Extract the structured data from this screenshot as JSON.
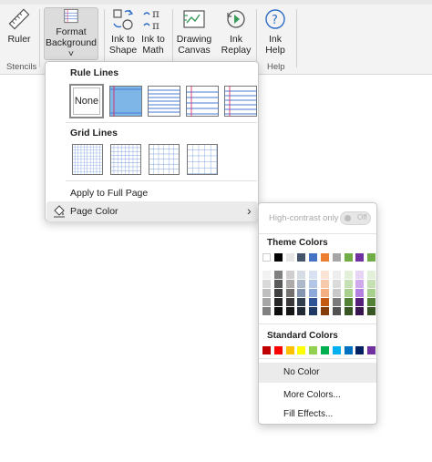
{
  "ribbon": {
    "ruler_label": "Ruler",
    "format_bg_line1": "Format",
    "format_bg_line2": "Background ˅",
    "ink_shape_line1": "Ink to",
    "ink_shape_line2": "Shape",
    "ink_math_line1": "Ink to",
    "ink_math_line2": "Math",
    "drawing_line1": "Drawing",
    "drawing_line2": "Canvas",
    "replay_line1": "Ink",
    "replay_line2": "Replay",
    "help_line1": "Ink",
    "help_line2": "Help",
    "group_stencils": "Stencils",
    "group_help": "Help"
  },
  "format_menu": {
    "rule_lines_heading": "Rule Lines",
    "none_label": "None",
    "grid_lines_heading": "Grid Lines",
    "apply_full_page": "Apply to Full Page",
    "page_color": "Page Color",
    "chevron": "›"
  },
  "page_color_menu": {
    "high_contrast": "High-contrast only",
    "toggle_state": "Off",
    "theme_colors_heading": "Theme Colors",
    "standard_colors_heading": "Standard Colors",
    "no_color": "No Color",
    "more_colors": "More Colors...",
    "fill_effects": "Fill Effects...",
    "theme_top_row": [
      "#ffffff",
      "#000000",
      "#e7e6e6",
      "#44546a",
      "#4472c4",
      "#ed7d31",
      "#a5a5a5",
      "#70ad47",
      "#7030a0",
      "#70ad47"
    ],
    "theme_shades": [
      [
        "#f2f2f2",
        "#808080",
        "#d0cece",
        "#d6dce4",
        "#d9e2f3",
        "#fbe4d5",
        "#ededed",
        "#e2efd9",
        "#e7d5f5",
        "#e2efd9"
      ],
      [
        "#d9d9d9",
        "#595959",
        "#aeaaaa",
        "#adb9ca",
        "#b4c6e7",
        "#f7caac",
        "#dbdbdb",
        "#c5e0b3",
        "#cfa9eb",
        "#c5e0b3"
      ],
      [
        "#bfbfbf",
        "#404040",
        "#757070",
        "#8496b0",
        "#8eaadb",
        "#f4b083",
        "#c9c9c9",
        "#a8d08d",
        "#b47fe0",
        "#a8d08d"
      ],
      [
        "#a6a6a6",
        "#262626",
        "#3a3838",
        "#323f4f",
        "#2f5496",
        "#c45911",
        "#7b7b7b",
        "#538135",
        "#551f7a",
        "#538135"
      ],
      [
        "#808080",
        "#0d0d0d",
        "#171616",
        "#222a35",
        "#1f3864",
        "#833c0b",
        "#525252",
        "#375623",
        "#381450",
        "#375623"
      ]
    ],
    "standard_colors": [
      "#c00000",
      "#ff0000",
      "#ffc000",
      "#ffff00",
      "#92d050",
      "#00b050",
      "#00b0f0",
      "#0070c0",
      "#002060",
      "#7030a0"
    ]
  }
}
